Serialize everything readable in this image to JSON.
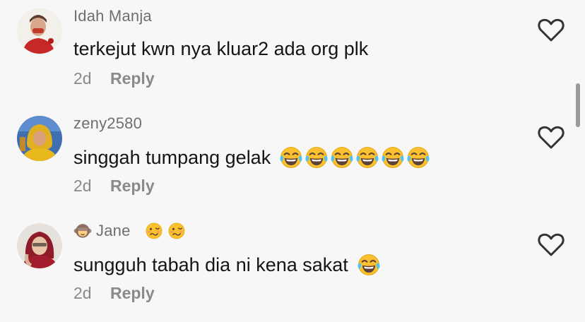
{
  "comments": [
    {
      "username": "Idah Manja",
      "text": "terkejut kwn nya kluar2 ada org plk",
      "time": "2d",
      "reply_label": "Reply",
      "avatar_icon": "profile-photo-red-outfit",
      "text_emoji_count": 0
    },
    {
      "username": "zeny2580",
      "text": "singgah tumpang gelak",
      "time": "2d",
      "reply_label": "Reply",
      "avatar_icon": "profile-photo-yellow-hijab",
      "text_emoji": "face-with-tears-of-joy",
      "text_emoji_count": 6
    },
    {
      "username": "Jane",
      "username_prefix_emoji": "see-no-evil-monkey",
      "username_suffix_emoji": "woozy-face",
      "username_suffix_emoji_count": 2,
      "text": "sungguh tabah dia ni kena sakat",
      "time": "2d",
      "reply_label": "Reply",
      "avatar_icon": "profile-photo-red-hijab",
      "text_emoji": "face-with-tears-of-joy",
      "text_emoji_count": 1
    }
  ],
  "like_icon": "heart-outline-icon",
  "colors": {
    "background": "#f7f7f7",
    "username": "#6f6f6f",
    "text": "#151515",
    "meta": "#8a8a8a",
    "emoji_yellow": "#fbc02d",
    "tear_blue": "#4fc3f7"
  }
}
